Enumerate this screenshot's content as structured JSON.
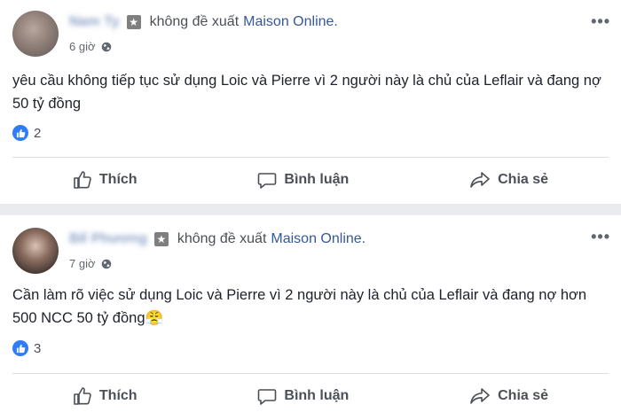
{
  "posts": [
    {
      "author_name": "Nam Ty",
      "verb": "không đề xuất",
      "page_name": "Maison Online.",
      "time": "6 giờ",
      "text": "yêu cầu không tiếp tục sử dụng Loic và Pierre vì 2 người này là chủ của Leflair và đang nợ 50 tỷ đồng",
      "like_count": "2",
      "actions": {
        "like": "Thích",
        "comment": "Bình luận",
        "share": "Chia sẻ"
      }
    },
    {
      "author_name": "Bế Phương",
      "verb": "không đề xuất",
      "page_name": "Maison Online.",
      "time": "7 giờ",
      "text": "Cần làm rõ việc sử dụng Loic và Pierre vì 2 người này là chủ của Leflair và đang nợ hơn 500 NCC 50 tỷ đồng😤",
      "like_count": "3",
      "actions": {
        "like": "Thích",
        "comment": "Bình luận",
        "share": "Chia sẻ"
      }
    }
  ],
  "colors": {
    "link": "#365899",
    "like_badge": "#2e7cf6",
    "background": "#e9ebee"
  }
}
